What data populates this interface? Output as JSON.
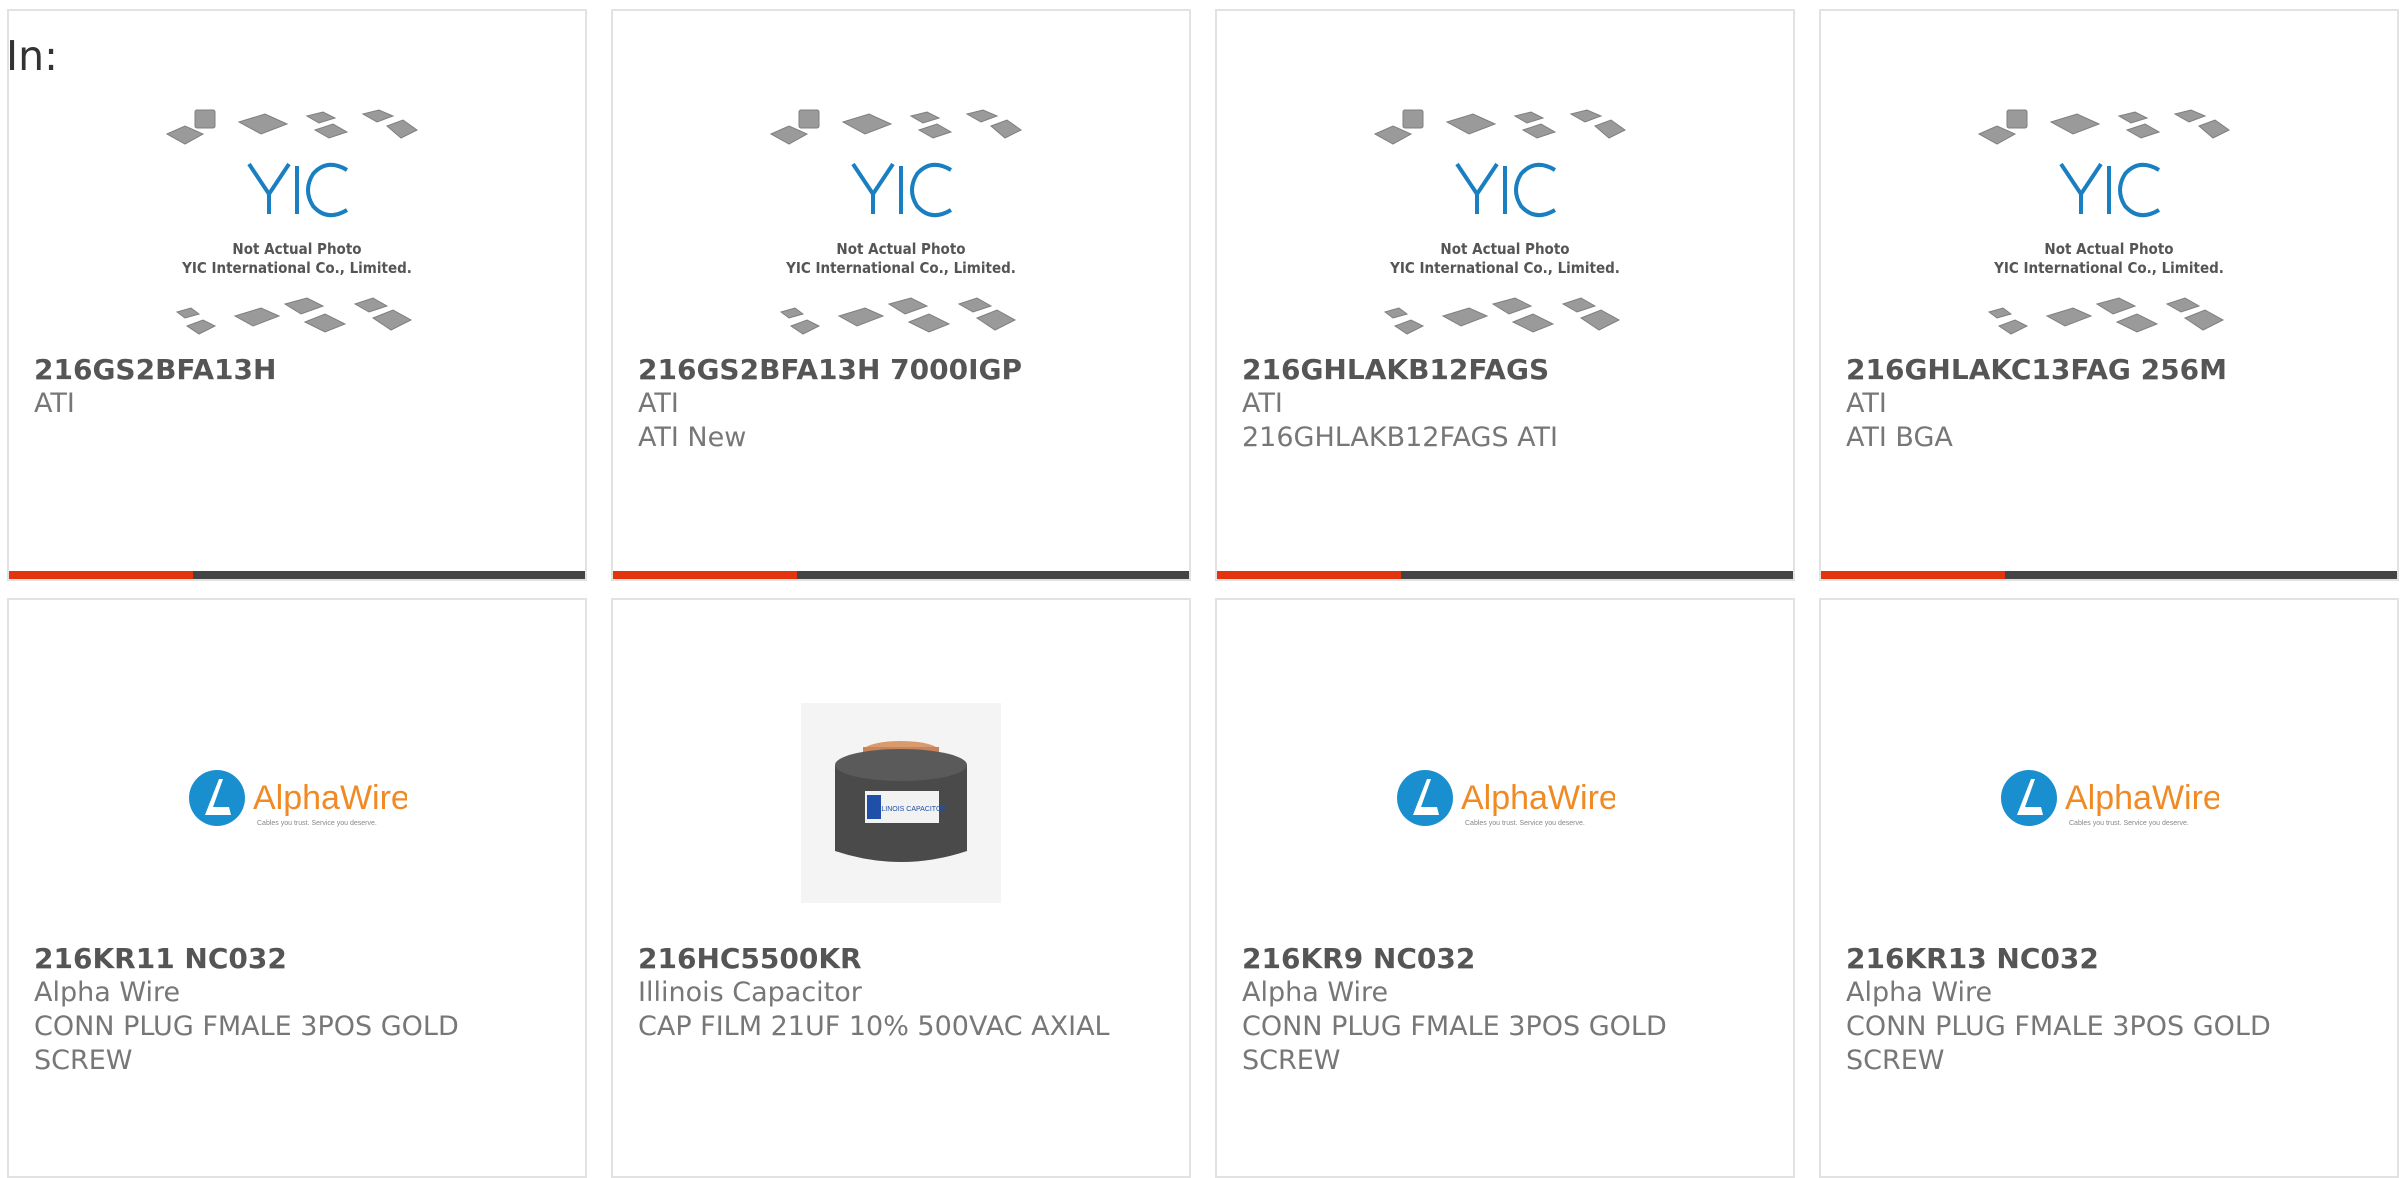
{
  "header": {
    "label": "In:"
  },
  "placeholder_image": {
    "logo": "YIC",
    "line1": "Not Actual Photo",
    "line2": "YIC International Co., Limited."
  },
  "alphawire_logo": {
    "brand": "AlphaWire",
    "tagline": "Cables you trust. Service you deserve."
  },
  "capacitor_image": {
    "label": "ILLINOIS CAPACITOR"
  },
  "colors": {
    "accent": "#e2350f",
    "bar": "#444444",
    "alphawire_blue": "#1a8fd0",
    "alphawire_orange": "#f08a24"
  },
  "products": [
    {
      "part": "216GS2BFA13H",
      "maker": "ATI",
      "desc": ""
    },
    {
      "part": "216GS2BFA13H 7000IGP",
      "maker": "ATI",
      "desc": "ATI New"
    },
    {
      "part": "216GHLAKB12FAGS",
      "maker": "ATI",
      "desc": "216GHLAKB12FAGS ATI"
    },
    {
      "part": "216GHLAKC13FAG 256M",
      "maker": "ATI",
      "desc": "ATI BGA"
    },
    {
      "part": "216KR11 NC032",
      "maker": "Alpha Wire",
      "desc": "CONN PLUG FMALE 3POS GOLD SCREW"
    },
    {
      "part": "216HC5500KR",
      "maker": "Illinois Capacitor",
      "desc": "CAP FILM 21UF 10% 500VAC AXIAL"
    },
    {
      "part": "216KR9 NC032",
      "maker": "Alpha Wire",
      "desc": "CONN PLUG FMALE 3POS GOLD SCREW"
    },
    {
      "part": "216KR13 NC032",
      "maker": "Alpha Wire",
      "desc": "CONN PLUG FMALE 3POS GOLD SCREW"
    }
  ]
}
